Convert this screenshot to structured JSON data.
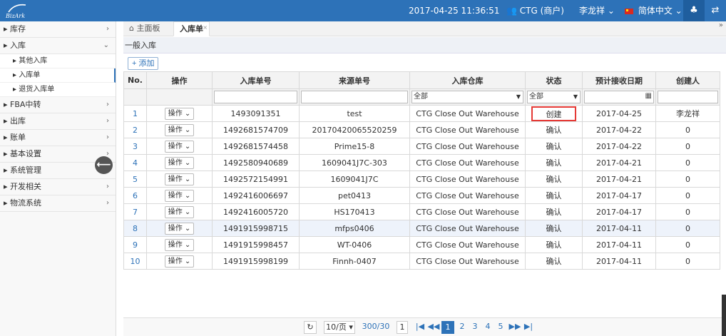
{
  "topbar": {
    "logo_text": "BizArk",
    "datetime": "2017-04-25 11:36:51",
    "company": "CTG (商户)",
    "user": "李龙祥",
    "language": "简体中文",
    "user_icon": "user-group-icon",
    "bell_icon": "bell-icon",
    "swap_icon": "swap-icon"
  },
  "sidebar": {
    "items": [
      {
        "label": "▸ 库存",
        "chev": "›"
      },
      {
        "label": "▸ 入库",
        "chev": "⌄"
      },
      {
        "label": "▸ FBA中转",
        "chev": "›"
      },
      {
        "label": "▸ 出库",
        "chev": "›"
      },
      {
        "label": "▸ 账单",
        "chev": "›"
      },
      {
        "label": "▸ 基本设置",
        "chev": "›"
      },
      {
        "label": "▸ 系统管理",
        "chev": "›"
      },
      {
        "label": "▸ 开发相关",
        "chev": "›"
      },
      {
        "label": "▸ 物流系统",
        "chev": "›"
      }
    ],
    "sub_items": [
      "▸ 其他入库",
      "▸ 入库单",
      "▸ 退货入库单"
    ],
    "collapse": "⟵"
  },
  "tabs": {
    "home": "主面板",
    "home_icon": "⌂",
    "active": "入库单",
    "close": "×",
    "more": "»"
  },
  "section": {
    "title": "一般入库",
    "add_button": "+ 添加"
  },
  "table": {
    "headers": [
      "No.",
      "操作",
      "入库单号",
      "来源单号",
      "入库仓库",
      "状态",
      "预计接收日期",
      "创建人"
    ],
    "filters": {
      "warehouse": "全部",
      "status": "全部",
      "date_icon": "▦"
    },
    "op_label": "操作 ⌄",
    "rows": [
      {
        "no": "1",
        "order": "1493091351",
        "source": "test",
        "warehouse": "CTG Close Out Warehouse",
        "status": "创建",
        "date": "2017-04-25",
        "creator": "李龙祥"
      },
      {
        "no": "2",
        "order": "1492681574709",
        "source": "20170420065520259",
        "warehouse": "CTG Close Out Warehouse",
        "status": "确认",
        "date": "2017-04-22",
        "creator": "0"
      },
      {
        "no": "3",
        "order": "1492681574458",
        "source": "Prime15-8",
        "warehouse": "CTG Close Out Warehouse",
        "status": "确认",
        "date": "2017-04-22",
        "creator": "0"
      },
      {
        "no": "4",
        "order": "1492580940689",
        "source": "1609041J7C-303",
        "warehouse": "CTG Close Out Warehouse",
        "status": "确认",
        "date": "2017-04-21",
        "creator": "0"
      },
      {
        "no": "5",
        "order": "1492572154991",
        "source": "1609041J7C",
        "warehouse": "CTG Close Out Warehouse",
        "status": "确认",
        "date": "2017-04-21",
        "creator": "0"
      },
      {
        "no": "6",
        "order": "1492416006697",
        "source": "pet0413",
        "warehouse": "CTG Close Out Warehouse",
        "status": "确认",
        "date": "2017-04-17",
        "creator": "0"
      },
      {
        "no": "7",
        "order": "1492416005720",
        "source": "HS170413",
        "warehouse": "CTG Close Out Warehouse",
        "status": "确认",
        "date": "2017-04-17",
        "creator": "0"
      },
      {
        "no": "8",
        "order": "1491915998715",
        "source": "mfps0406",
        "warehouse": "CTG Close Out Warehouse",
        "status": "确认",
        "date": "2017-04-11",
        "creator": "0"
      },
      {
        "no": "9",
        "order": "1491915998457",
        "source": "WT-0406",
        "warehouse": "CTG Close Out Warehouse",
        "status": "确认",
        "date": "2017-04-11",
        "creator": "0"
      },
      {
        "no": "10",
        "order": "1491915998199",
        "source": "Finnh-0407",
        "warehouse": "CTG Close Out Warehouse",
        "status": "确认",
        "date": "2017-04-11",
        "creator": "0"
      }
    ]
  },
  "pager": {
    "refresh": "↻",
    "page_size": "10/页 ▾",
    "total": "300/30",
    "current_input": "1",
    "first": "|◀",
    "prev": "◀◀",
    "pages": [
      "1",
      "2",
      "3",
      "4",
      "5"
    ],
    "next": "▶▶",
    "last": "▶|"
  }
}
